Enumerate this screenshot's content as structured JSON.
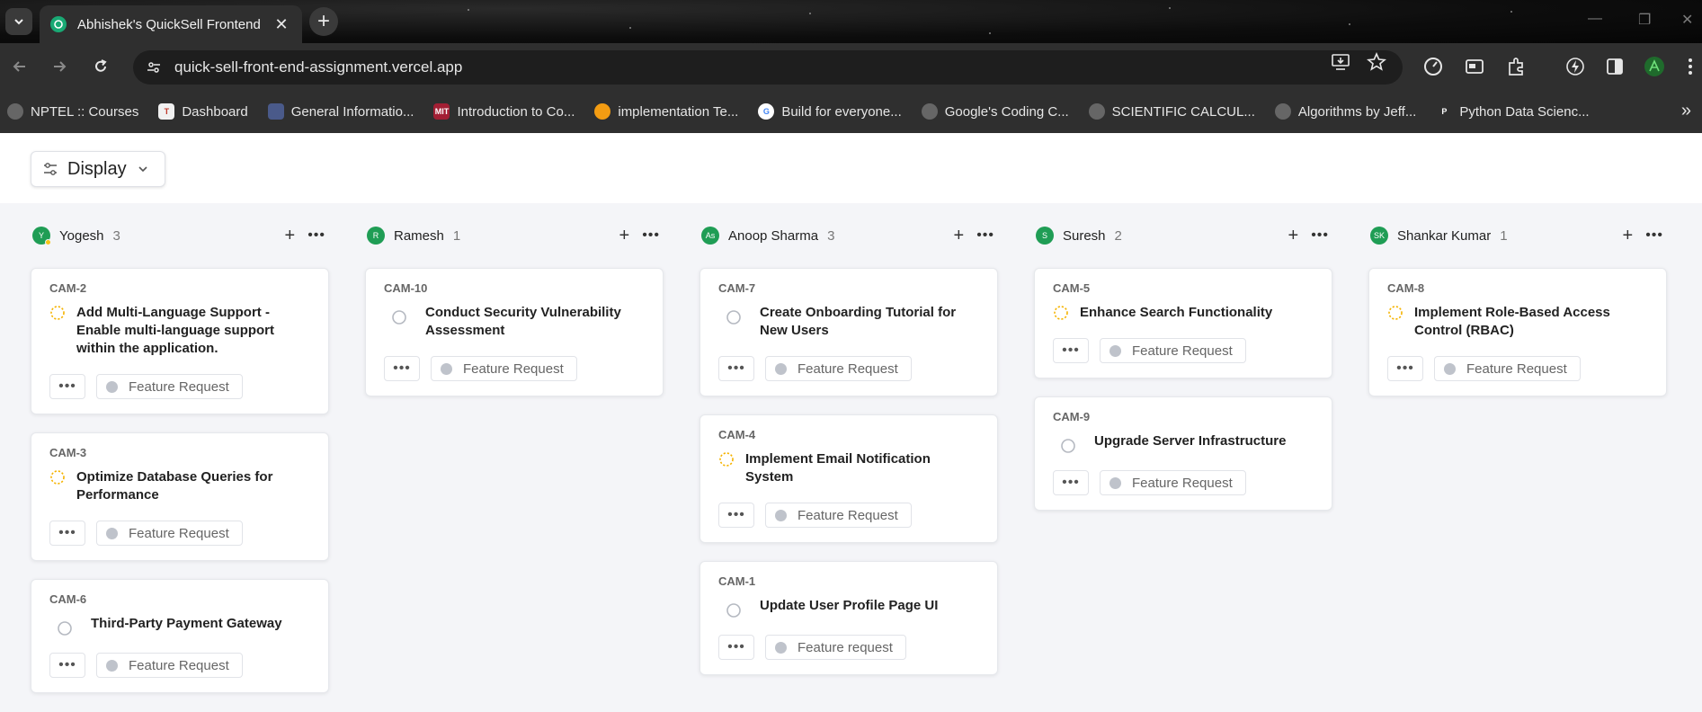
{
  "browser": {
    "tab_title": "Abhishek's QuickSell Frontend",
    "url": "quick-sell-front-end-assignment.vercel.app",
    "bookmarks": [
      {
        "label": "NPTEL :: Courses",
        "icon": "globe-icon"
      },
      {
        "label": "Dashboard",
        "icon": "dashboard-icon"
      },
      {
        "label": "General Informatio...",
        "icon": "generic-icon"
      },
      {
        "label": "Introduction to Co...",
        "icon": "mit-icon"
      },
      {
        "label": "implementation Te...",
        "icon": "balloon-icon"
      },
      {
        "label": "Build for everyone...",
        "icon": "google-icon"
      },
      {
        "label": "Google's Coding C...",
        "icon": "globe-icon"
      },
      {
        "label": "SCIENTIFIC CALCUL...",
        "icon": "globe-icon"
      },
      {
        "label": "Algorithms by Jeff...",
        "icon": "globe-icon"
      },
      {
        "label": "Python Data Scienc...",
        "icon": "p-icon"
      }
    ]
  },
  "header": {
    "display_label": "Display"
  },
  "columns": [
    {
      "name": "Yogesh",
      "count": "3",
      "initials": "Y",
      "presence": "away",
      "cards": [
        {
          "id": "CAM-2",
          "title": "Add Multi-Language Support - Enable multi-language support within the application.",
          "status": "in-progress",
          "tag": "Feature Request"
        },
        {
          "id": "CAM-3",
          "title": "Optimize Database Queries for Performance",
          "status": "in-progress",
          "tag": "Feature Request"
        },
        {
          "id": "CAM-6",
          "title": "Third-Party Payment Gateway",
          "status": "todo",
          "tag": "Feature Request"
        }
      ]
    },
    {
      "name": "Ramesh",
      "count": "1",
      "initials": "R",
      "presence": "online",
      "cards": [
        {
          "id": "CAM-10",
          "title": "Conduct Security Vulnerability Assessment",
          "status": "todo",
          "tag": "Feature Request"
        }
      ]
    },
    {
      "name": "Anoop Sharma",
      "count": "3",
      "initials": "As",
      "presence": "online",
      "cards": [
        {
          "id": "CAM-7",
          "title": "Create Onboarding Tutorial for New Users",
          "status": "todo",
          "tag": "Feature Request"
        },
        {
          "id": "CAM-4",
          "title": "Implement Email Notification System",
          "status": "in-progress",
          "tag": "Feature Request"
        },
        {
          "id": "CAM-1",
          "title": "Update User Profile Page UI",
          "status": "todo",
          "tag": "Feature request"
        }
      ]
    },
    {
      "name": "Suresh",
      "count": "2",
      "initials": "S",
      "presence": "online",
      "cards": [
        {
          "id": "CAM-5",
          "title": "Enhance Search Functionality",
          "status": "in-progress",
          "tag": "Feature Request"
        },
        {
          "id": "CAM-9",
          "title": "Upgrade Server Infrastructure",
          "status": "todo",
          "tag": "Feature Request"
        }
      ]
    },
    {
      "name": "Shankar Kumar",
      "count": "1",
      "initials": "SK",
      "presence": "online",
      "cards": [
        {
          "id": "CAM-8",
          "title": "Implement Role-Based Access Control (RBAC)",
          "status": "in-progress",
          "tag": "Feature Request"
        }
      ]
    }
  ],
  "colors": {
    "avatar_bg": "#1f9d55",
    "in_progress": "#f5b301",
    "todo": "#b5b9c1",
    "tag_dot": "#bfc3cb"
  }
}
